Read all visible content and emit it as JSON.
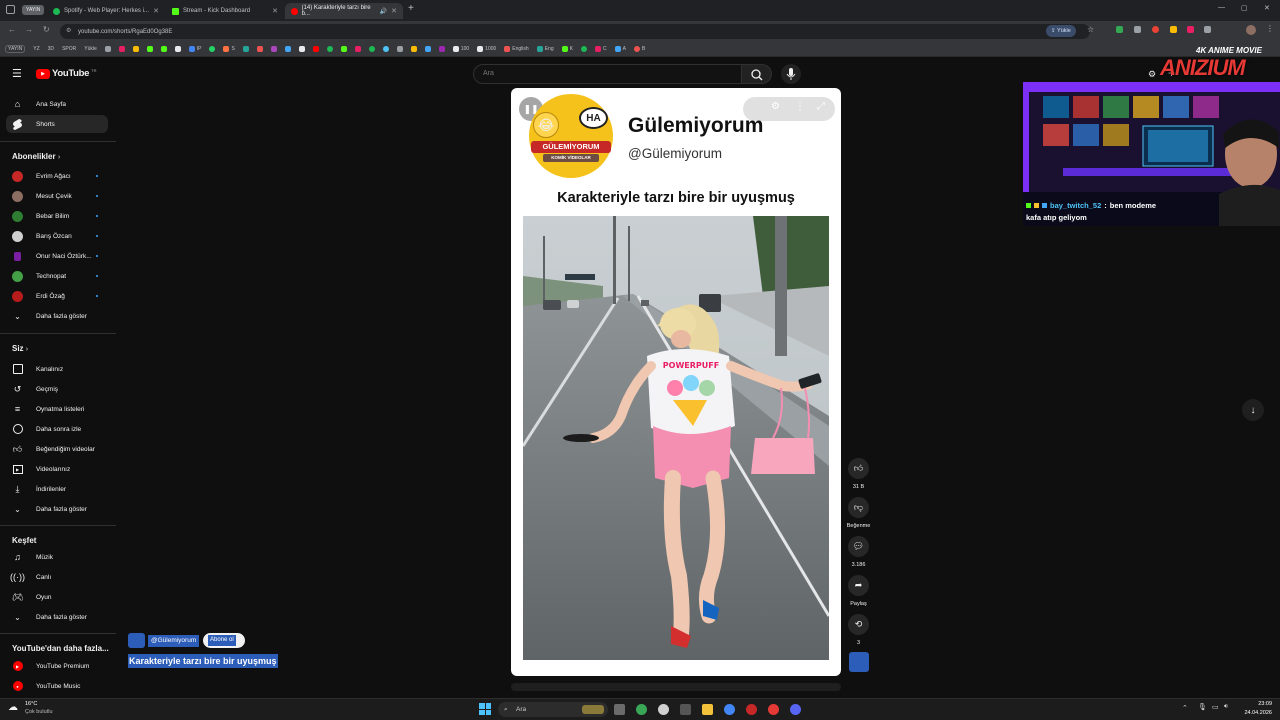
{
  "browser": {
    "yayin_badge": "YAYIN",
    "tabs": [
      {
        "title": "Spotify - Web Player: Herkes i...",
        "color": "#1db954"
      },
      {
        "title": "Stream - Kick Dashboard",
        "color": "#53fc18"
      },
      {
        "title": "(14) Karakteriyle tarzı bire b...",
        "color": "#ff0000"
      }
    ],
    "new_tab": "+",
    "url": "youtube.com/shorts/RgaEd0Og38E",
    "upload_label": "Yükle",
    "bookmarks": [
      "YAYIN",
      "YZ",
      "3D",
      "SPOR",
      "Yükle",
      "IP",
      "S",
      "100",
      "1000",
      "English",
      "Eng",
      "K",
      "C",
      "A",
      "B"
    ]
  },
  "youtube": {
    "logo": "YouTube",
    "logo_region": "TR",
    "search_placeholder": "Ara",
    "sidebar": {
      "main": [
        {
          "label": "Ana Sayfa",
          "icon": "home-icon"
        },
        {
          "label": "Shorts",
          "icon": "shorts-icon"
        }
      ],
      "subs_title": "Abonelikler",
      "subs": [
        {
          "label": "Evrim Ağacı",
          "color": "#c62828"
        },
        {
          "label": "Mesut Çevik",
          "color": "#8d6e63"
        },
        {
          "label": "Bebar Bilim",
          "color": "#2e7d32"
        },
        {
          "label": "Barış Özcan",
          "color": "#cfcfcf"
        },
        {
          "label": "Onur Naci Öztürk...",
          "color": "#7b1fa2"
        },
        {
          "label": "Technopat",
          "color": "#43a047"
        },
        {
          "label": "Erdi Özağ",
          "color": "#b71c1c"
        }
      ],
      "subs_more": "Daha fazla göster",
      "you_title": "Siz",
      "you": [
        {
          "label": "Kanalınız",
          "icon": "channel-icon"
        },
        {
          "label": "Geçmiş",
          "icon": "history-icon"
        },
        {
          "label": "Oynatma listeleri",
          "icon": "playlist-icon"
        },
        {
          "label": "Daha sonra izle",
          "icon": "clock-icon"
        },
        {
          "label": "Beğendiğim videolar",
          "icon": "like-icon"
        },
        {
          "label": "Videolarınız",
          "icon": "video-icon"
        },
        {
          "label": "İndirilenler",
          "icon": "download-icon"
        }
      ],
      "you_more": "Daha fazla göster",
      "explore_title": "Keşfet",
      "explore": [
        {
          "label": "Müzik",
          "icon": "music-icon"
        },
        {
          "label": "Canlı",
          "icon": "live-icon"
        },
        {
          "label": "Oyun",
          "icon": "gaming-icon"
        }
      ],
      "explore_more": "Daha fazla göster",
      "more_title": "YouTube'dan daha fazla...",
      "more": [
        {
          "label": "YouTube Premium"
        },
        {
          "label": "YouTube Music"
        }
      ]
    },
    "short": {
      "channel_title": "Gülemiyorum",
      "channel_handle": "@Gülemiyorum",
      "caption": "Karakteriyle tarzı bire bir uyuşmuş",
      "logo_text": "GÜLEMİYORUM",
      "logo_sub": "KOMİK VİDEOLAR",
      "logo_bubble": "HA",
      "shirt_text": "POWERPUFF"
    },
    "meta": {
      "handle": "@Gülemiyorum",
      "subscribe": "Abone ol",
      "title": "Karakteriyle tarzı bire bir uyuşmuş"
    },
    "actions": [
      {
        "icon": "like-icon",
        "label": "31 B"
      },
      {
        "icon": "dislike-icon",
        "label": "Beğenme"
      },
      {
        "icon": "comment-icon",
        "label": "3.186"
      },
      {
        "icon": "share-icon",
        "label": "Paylaş"
      },
      {
        "icon": "remix-icon",
        "label": "3"
      }
    ]
  },
  "stream": {
    "watermark_top": "4K ANIME MOVIE",
    "watermark_main": "ANIZIUM",
    "chat_user": "bay_twitch_52",
    "chat_sep": ":",
    "chat_msg": "ben modeme",
    "chat_msg2": "kafa atıp geliyom"
  },
  "taskbar": {
    "weather_temp": "16°C",
    "weather_desc": "Çok bulutlu",
    "search": "Ara",
    "time": "23:09",
    "date": "24.04.2026"
  }
}
